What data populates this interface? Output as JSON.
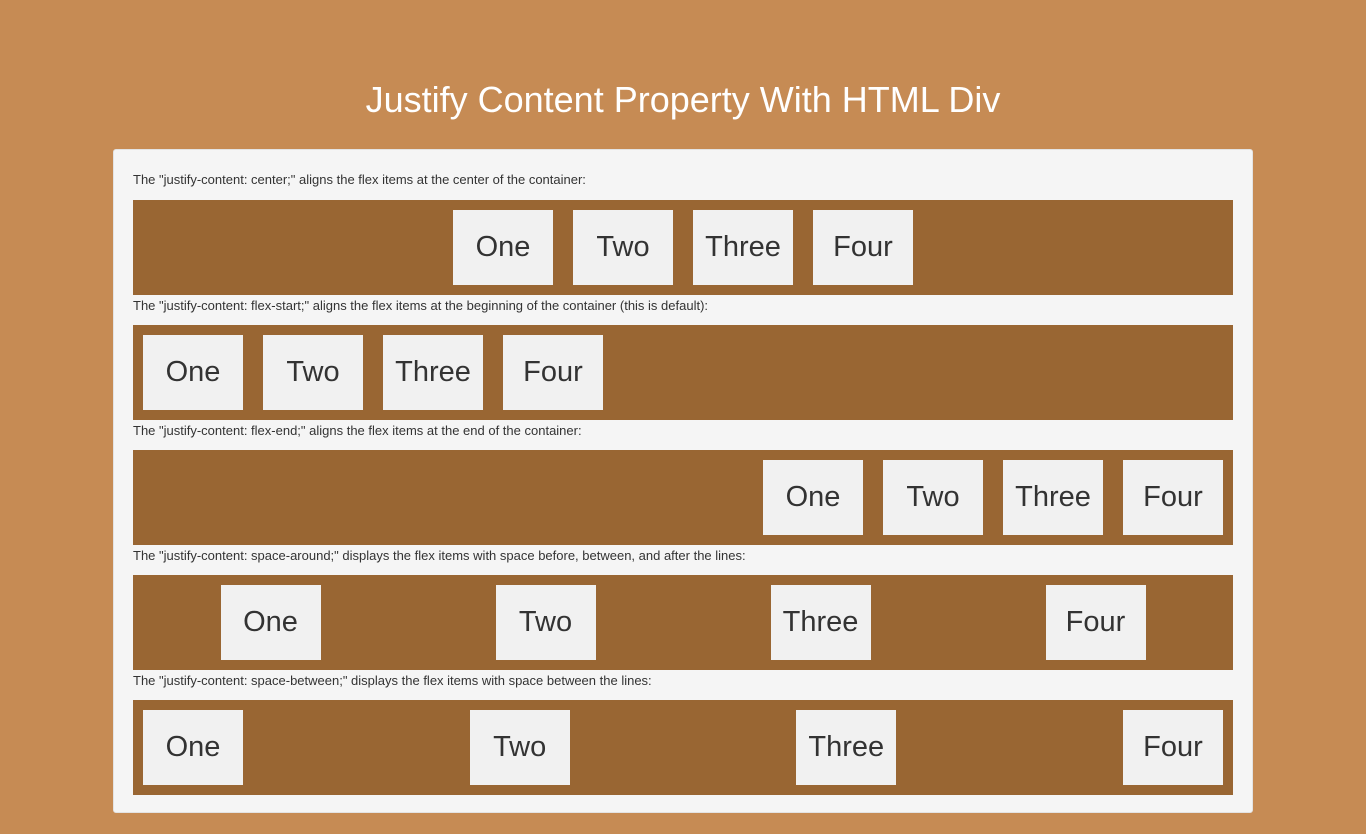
{
  "page": {
    "title": "Justify Content Property With HTML Div",
    "colors": {
      "background": "#c68b54",
      "card": "#f5f5f5",
      "flex_container": "#996633",
      "flex_item": "#f1f1f1",
      "text": "#333333"
    }
  },
  "sections": [
    {
      "description": "The \"justify-content: center;\" aligns the flex items at the center of the container:",
      "justify": "center",
      "items": [
        "One",
        "Two",
        "Three",
        "Four"
      ]
    },
    {
      "description": "The \"justify-content: flex-start;\" aligns the flex items at the beginning of the container (this is default):",
      "justify": "flex-start",
      "items": [
        "One",
        "Two",
        "Three",
        "Four"
      ]
    },
    {
      "description": "The \"justify-content: flex-end;\" aligns the flex items at the end of the container:",
      "justify": "flex-end",
      "items": [
        "One",
        "Two",
        "Three",
        "Four"
      ]
    },
    {
      "description": "The \"justify-content: space-around;\" displays the flex items with space before, between, and after the lines:",
      "justify": "space-around",
      "items": [
        "One",
        "Two",
        "Three",
        "Four"
      ]
    },
    {
      "description": "The \"justify-content: space-between;\" displays the flex items with space between the lines:",
      "justify": "space-between",
      "items": [
        "One",
        "Two",
        "Three",
        "Four"
      ]
    }
  ]
}
